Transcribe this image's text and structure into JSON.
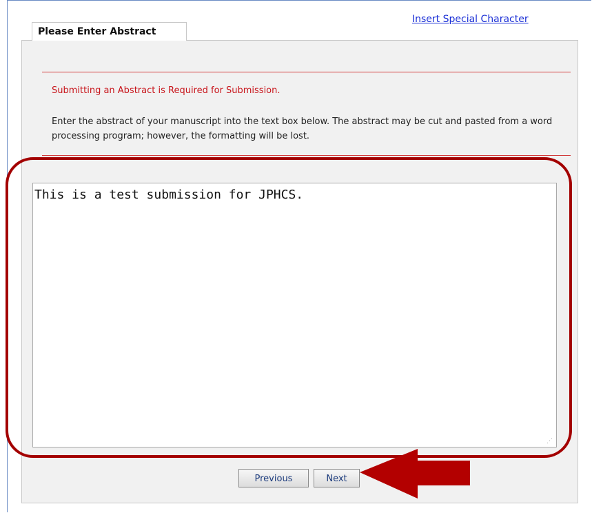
{
  "header": {
    "special_char_link": "Insert Special Character"
  },
  "tab": {
    "label": "Please Enter Abstract"
  },
  "form": {
    "required_notice": "Submitting an Abstract is Required for Submission.",
    "instructions": "Enter the abstract of your manuscript into the text box below. The abstract may be cut and pasted from a word processing program; however, the formatting will be lost.",
    "abstract_value": "This is a test submission for JPHCS."
  },
  "buttons": {
    "previous": "Previous",
    "next": "Next"
  },
  "colors": {
    "annotation": "#a30000",
    "notice": "#c8151b",
    "link": "#1a2fd6",
    "panel": "#f1f1f1"
  },
  "icons": {
    "annotation_arrow": "arrow-left-icon",
    "resize_grip": "resize-grip-icon"
  }
}
